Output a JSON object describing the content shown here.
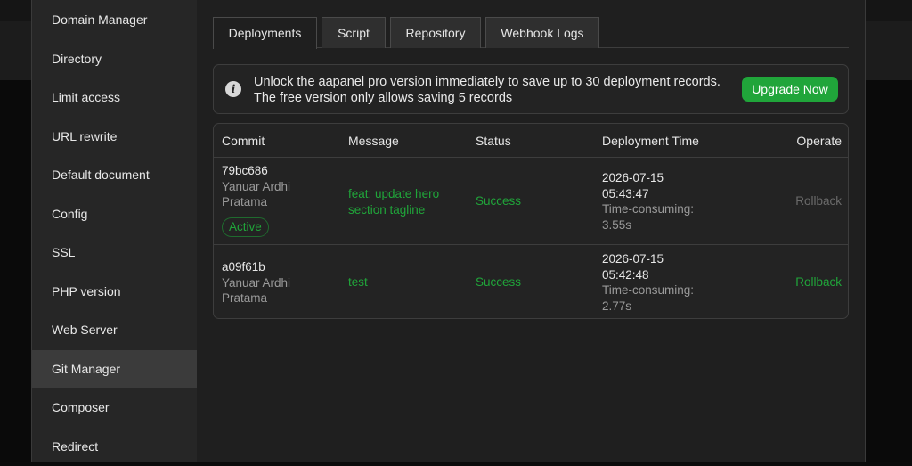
{
  "sidebar": {
    "items": [
      {
        "label": "Domain Manager",
        "active": false
      },
      {
        "label": "Directory",
        "active": false
      },
      {
        "label": "Limit access",
        "active": false
      },
      {
        "label": "URL rewrite",
        "active": false
      },
      {
        "label": "Default document",
        "active": false
      },
      {
        "label": "Config",
        "active": false
      },
      {
        "label": "SSL",
        "active": false
      },
      {
        "label": "PHP version",
        "active": false
      },
      {
        "label": "Web Server",
        "active": false
      },
      {
        "label": "Git Manager",
        "active": true
      },
      {
        "label": "Composer",
        "active": false
      },
      {
        "label": "Redirect",
        "active": false
      }
    ]
  },
  "tabs": [
    {
      "label": "Deployments",
      "active": true
    },
    {
      "label": "Script",
      "active": false
    },
    {
      "label": "Repository",
      "active": false
    },
    {
      "label": "Webhook Logs",
      "active": false
    }
  ],
  "notice": {
    "icon": "info-icon",
    "text": "Unlock the aapanel pro version immediately to save up to 30 deployment records. The free version only allows saving 5 records",
    "button_label": "Upgrade Now"
  },
  "table": {
    "headers": {
      "commit": "Commit",
      "message": "Message",
      "status": "Status",
      "deployment_time": "Deployment Time",
      "operate": "Operate"
    },
    "rows": [
      {
        "commit": "79bc686",
        "author": "Yanuar Ardhi Pratama",
        "badge": "Active",
        "message": "feat: update hero section tagline",
        "status": "Success",
        "date": "2026-07-15",
        "time": "05:43:47",
        "duration_label": "Time-consuming:",
        "duration": "3.55s",
        "operate": "Rollback",
        "operate_enabled": false
      },
      {
        "commit": "a09f61b",
        "author": "Yanuar Ardhi Pratama",
        "badge": "",
        "message": "test",
        "status": "Success",
        "date": "2026-07-15",
        "time": "05:42:48",
        "duration_label": "Time-consuming:",
        "duration": "2.77s",
        "operate": "Rollback",
        "operate_enabled": true
      }
    ]
  },
  "colors": {
    "accent": "#20a53a",
    "background": "#1f1f1f",
    "sidebar": "#262626",
    "sidebar_active": "#3b3b3b",
    "muted_text": "#9a9a9a"
  }
}
